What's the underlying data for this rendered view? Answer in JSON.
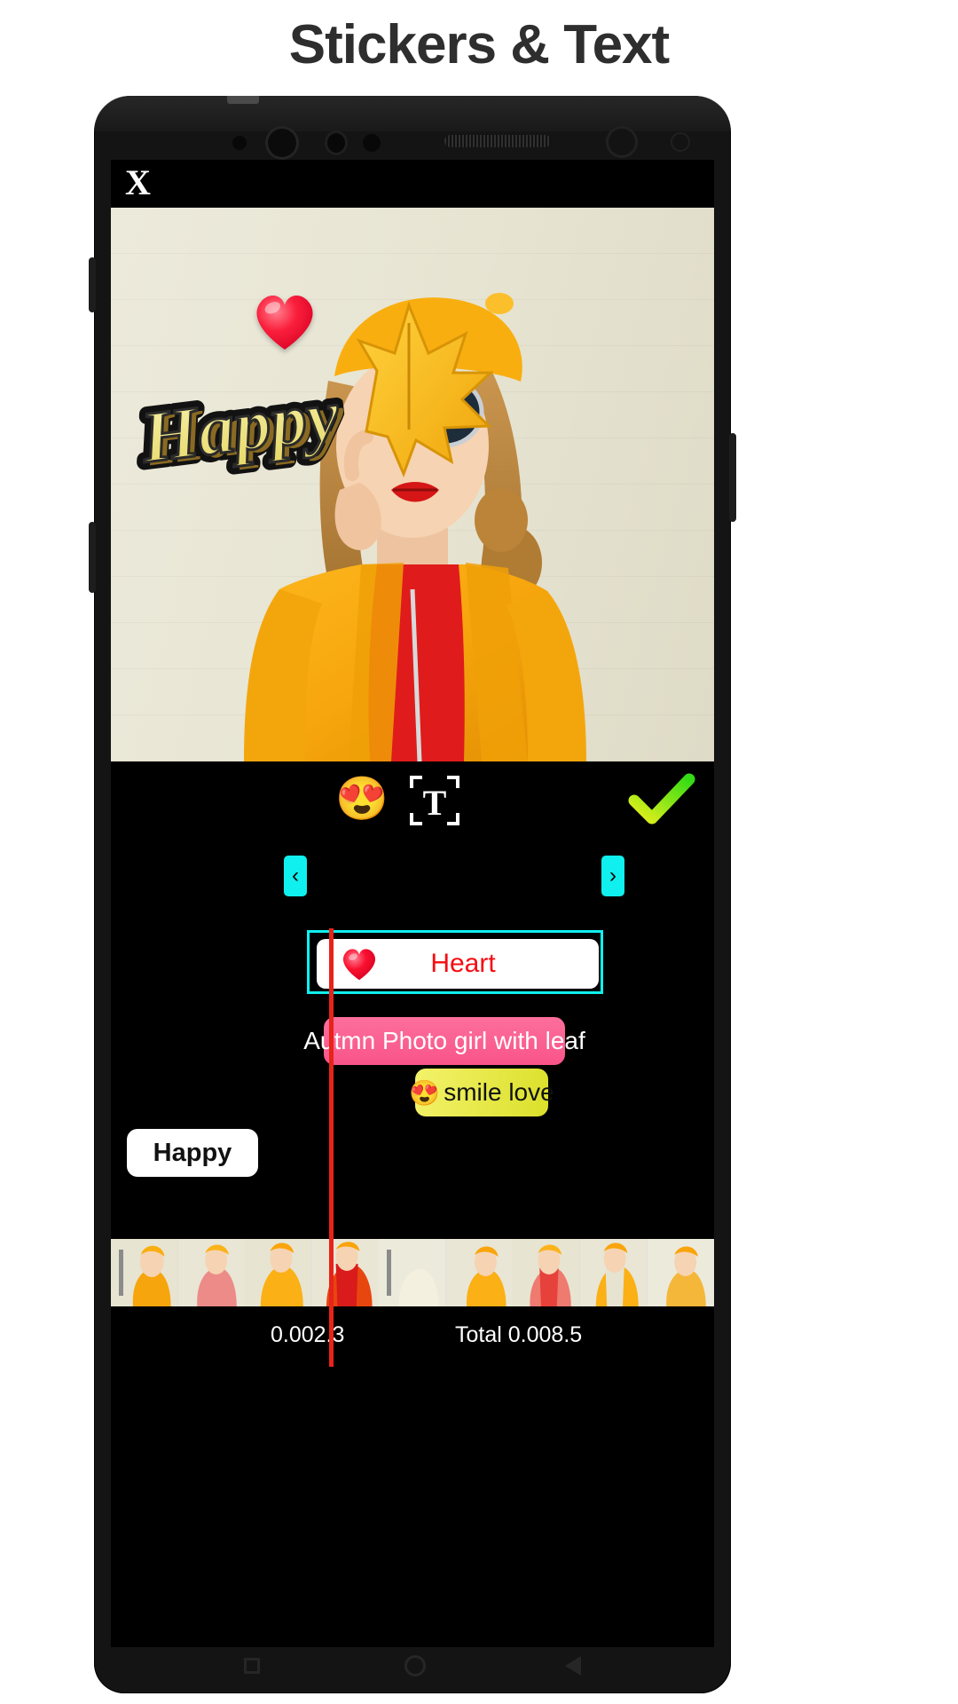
{
  "page": {
    "title": "Stickers & Text"
  },
  "app": {
    "close_label": "X",
    "toolbar": {
      "sticker_icon": "heart-eyes-emoji",
      "sticker_glyph": "😍",
      "text_icon": "text-tool-icon",
      "text_glyph": "T",
      "confirm_icon": "check-icon"
    },
    "canvas": {
      "stickers": [
        {
          "name": "heart-sticker",
          "type": "heart",
          "label": "Heart"
        },
        {
          "name": "happy-word-sticker",
          "type": "word-art",
          "label": "Happy"
        }
      ]
    },
    "timeline": {
      "selected_clip": {
        "label": "Heart",
        "icon": "heart-icon",
        "prev_handle": "‹",
        "next_handle": "›"
      },
      "clips": [
        {
          "name": "clip-pink",
          "label": "Autmn Photo  girl with leaf"
        },
        {
          "name": "clip-yellow",
          "label": "smile love",
          "emoji": "😍"
        },
        {
          "name": "clip-white",
          "label": "Happy"
        }
      ],
      "current_time": "0.002.3",
      "total_time": "Total 0.008.5"
    },
    "colors": {
      "selection": "#0ff0ef",
      "playhead": "#e7231a",
      "pink_clip": "#f9548a",
      "yellow_clip": "#dbe02a",
      "confirm_green": "#38e022",
      "heart_red": "#f40d12",
      "title_gray": "#2e2e2e"
    }
  }
}
